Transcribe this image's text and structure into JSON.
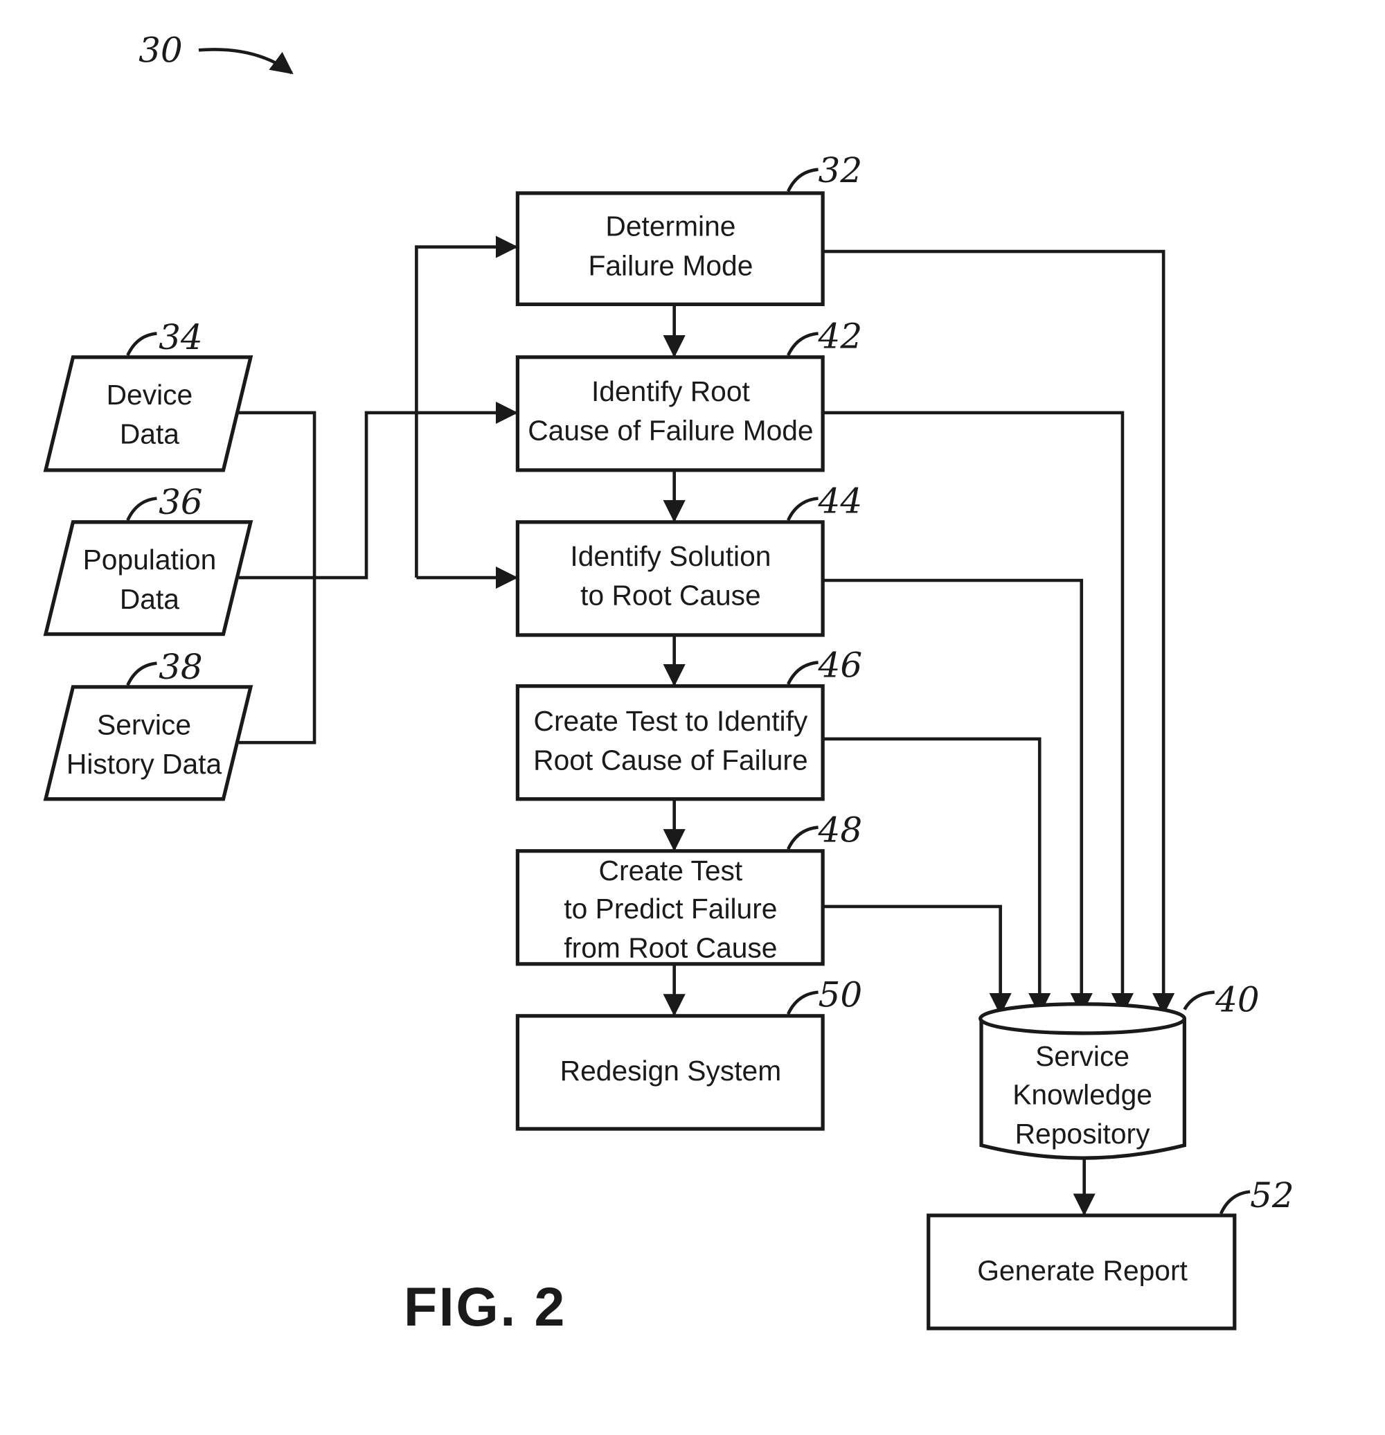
{
  "figure": {
    "number": "30",
    "caption": "FIG. 2"
  },
  "process_boxes": [
    {
      "ref": "32",
      "lines": [
        "Determine",
        "Failure Mode"
      ]
    },
    {
      "ref": "42",
      "lines": [
        "Identify Root",
        "Cause of Failure Mode"
      ]
    },
    {
      "ref": "44",
      "lines": [
        "Identify Solution",
        "to Root Cause"
      ]
    },
    {
      "ref": "46",
      "lines": [
        "Create Test to Identify",
        "Root Cause of Failure"
      ]
    },
    {
      "ref": "48",
      "lines": [
        "Create Test",
        "to Predict Failure",
        "from Root Cause"
      ]
    },
    {
      "ref": "50",
      "lines": [
        "Redesign System"
      ]
    }
  ],
  "data_inputs": [
    {
      "ref": "34",
      "lines": [
        "Device",
        "Data"
      ]
    },
    {
      "ref": "36",
      "lines": [
        "Population",
        "Data"
      ]
    },
    {
      "ref": "38",
      "lines": [
        "Service",
        "History Data"
      ]
    }
  ],
  "repository": {
    "ref": "40",
    "lines": [
      "Service",
      "Knowledge",
      "Repository"
    ]
  },
  "report": {
    "ref": "52",
    "lines": [
      "Generate Report"
    ]
  }
}
